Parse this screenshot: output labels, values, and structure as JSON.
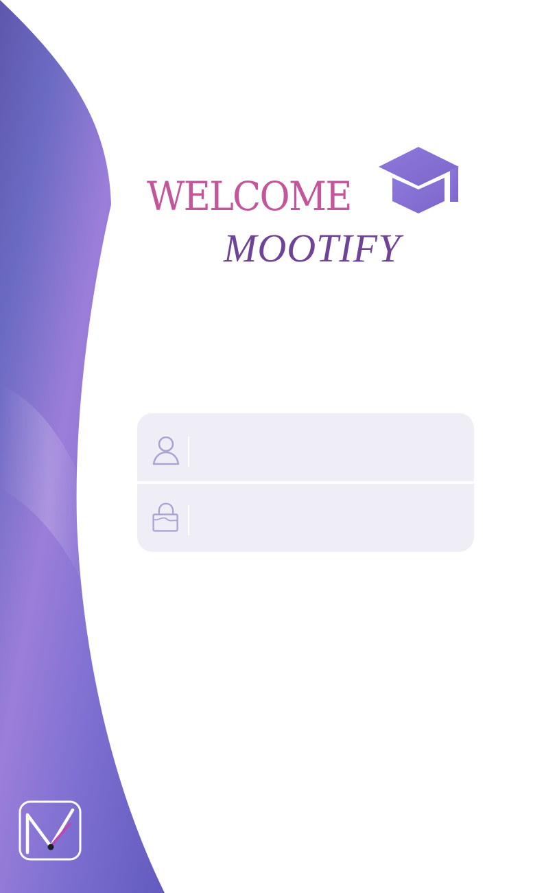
{
  "header": {
    "welcome_text": "WELCOME",
    "brand_name": "MOOTIFY"
  },
  "login_form": {
    "username": {
      "icon": "user-icon",
      "value": "",
      "placeholder": ""
    },
    "password": {
      "icon": "lock-icon",
      "value": "",
      "placeholder": ""
    }
  },
  "icons": {
    "hero": "graduation-cap-icon",
    "bottom_logo": "mootify-m-logo"
  },
  "colors": {
    "wave_primary": "#6f65c2",
    "wave_light": "#9a7fd8",
    "welcome_pink": "#c3559a",
    "brand_purple": "#6f4395",
    "cap_purple": "#8c74d8",
    "field_background": "#efeef7",
    "field_icon": "#aaa3d2"
  }
}
